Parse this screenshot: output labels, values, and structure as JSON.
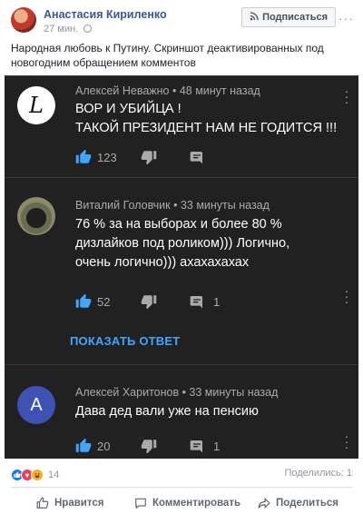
{
  "post": {
    "author": "Анастасия Кириленко",
    "time": "27 мин.",
    "subscribe_label": "Подписаться",
    "text": "Народная любовь к Путину. Скриншот деактивированных под новогодним обращением комментов"
  },
  "screenshot": {
    "comments": [
      {
        "author_line": "Алексей Неважно • 48 минут назад",
        "text_lines": [
          "ВОР И УБИЙЦА !",
          "ТАКОЙ ПРЕЗИДЕНТ НАМ НЕ ГОДИТСЯ !!!"
        ],
        "likes": "123",
        "replies": "",
        "avatar_letter": "L"
      },
      {
        "author_line": "Виталий Головчик • 33 минуты назад",
        "text_lines": [
          "76 % за на выборах и более 80 %",
          "дизлайков под роликом))) Логично,",
          "очень логично))) ахахахахах"
        ],
        "likes": "52",
        "replies": "1",
        "avatar_letter": ""
      },
      {
        "author_line": "Алексей Харитонов • 33 минуты назад",
        "text_lines": [
          "Дава дед вали уже на пенсию"
        ],
        "likes": "20",
        "replies": "1",
        "avatar_letter": "A"
      }
    ],
    "show_reply_label": "ПОКАЗАТЬ ОТВЕТ"
  },
  "reactions": {
    "count": "14",
    "shares": "Поделились: 1"
  },
  "footer": {
    "like_label": "Нравится",
    "comment_label": "Комментировать",
    "share_label": "Поделиться"
  },
  "colors": {
    "facebook_link": "#385898",
    "dark_bg": "#212121",
    "youtube_link": "#3ea6ff",
    "like_blue": "#3ea6ff"
  }
}
